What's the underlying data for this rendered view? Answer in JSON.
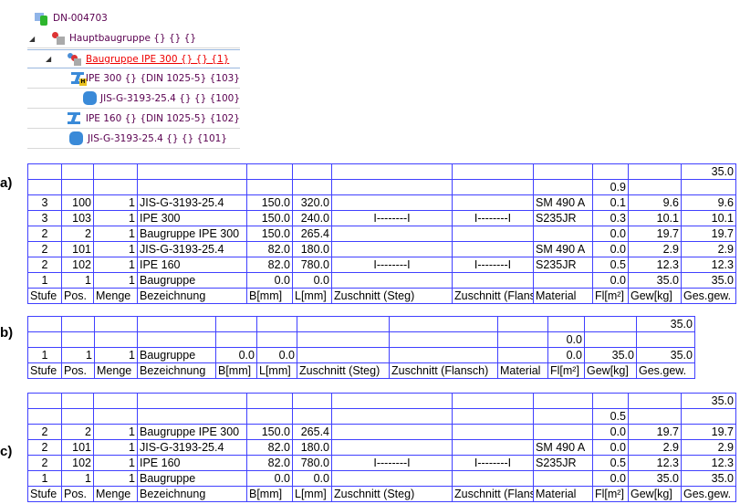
{
  "tree": {
    "root": "DN-004703",
    "items": [
      {
        "label": "Hauptbaugruppe {} {} {}",
        "icon": "assembly-icon",
        "expanded": true
      },
      {
        "label": "Baugruppe IPE 300 {} {} {1}",
        "icon": "assembly-icon",
        "expanded": true,
        "selected": true
      },
      {
        "label": "IPE 300 {} {DIN 1025-5} {103}",
        "icon": "i-beam-icon"
      },
      {
        "label": "JIS-G-3193-25.4 {} {} {100}",
        "icon": "plate-icon"
      },
      {
        "label": "IPE 160 {} {DIN 1025-5} {102}",
        "icon": "i-beam-icon"
      },
      {
        "label": "JIS-G-3193-25.4 {} {} {101}",
        "icon": "plate-icon"
      }
    ]
  },
  "sections": {
    "a": {
      "label": "a)",
      "rows": [
        [
          "",
          "",
          "",
          "",
          "",
          "",
          "",
          "",
          "",
          "",
          "",
          "35.0"
        ],
        [
          "",
          "",
          "",
          "",
          "",
          "",
          "",
          "",
          "",
          "0.9",
          "",
          ""
        ],
        [
          "3",
          "100",
          "1",
          "JIS-G-3193-25.4",
          "150.0",
          "320.0",
          "",
          "",
          "SM 490 A",
          "0.1",
          "9.6",
          "9.6"
        ],
        [
          "3",
          "103",
          "1",
          "IPE 300",
          "150.0",
          "240.0",
          "I--------I",
          "I--------I",
          "S235JR",
          "0.3",
          "10.1",
          "10.1"
        ],
        [
          "2",
          "2",
          "1",
          "Baugruppe IPE 300",
          "150.0",
          "265.4",
          "",
          "",
          "",
          "0.0",
          "19.7",
          "19.7"
        ],
        [
          "2",
          "101",
          "1",
          "JIS-G-3193-25.4",
          "82.0",
          "180.0",
          "",
          "",
          "SM 490 A",
          "0.0",
          "2.9",
          "2.9"
        ],
        [
          "2",
          "102",
          "1",
          "IPE 160",
          "82.0",
          "780.0",
          "I--------I",
          "I--------I",
          "S235JR",
          "0.5",
          "12.3",
          "12.3"
        ],
        [
          "1",
          "1",
          "1",
          "Baugruppe",
          "0.0",
          "0.0",
          "",
          "",
          "",
          "0.0",
          "35.0",
          "35.0"
        ],
        [
          "Stufe",
          "Pos.",
          "Menge",
          "Bezeichnung",
          "B[mm]",
          "L[mm]",
          "Zuschnitt (Steg)",
          "Zuschnitt (Flansch)",
          "Material",
          "Fl[m²]",
          "Gew[kg]",
          "Ges.gew."
        ]
      ]
    },
    "b": {
      "label": "b)",
      "rows": [
        [
          "",
          "",
          "",
          "",
          "",
          "",
          "",
          "",
          "",
          "",
          "",
          "35.0"
        ],
        [
          "",
          "",
          "",
          "",
          "",
          "",
          "",
          "",
          "",
          "0.0",
          "",
          ""
        ],
        [
          "1",
          "1",
          "1",
          "Baugruppe",
          "0.0",
          "0.0",
          "",
          "",
          "",
          "0.0",
          "35.0",
          "35.0"
        ],
        [
          "Stufe",
          "Pos.",
          "Menge",
          "Bezeichnung",
          "B[mm]",
          "L[mm]",
          "Zuschnitt (Steg)",
          "Zuschnitt (Flansch)",
          "Material",
          "Fl[m²]",
          "Gew[kg]",
          "Ges.gew."
        ]
      ]
    },
    "c": {
      "label": "c)",
      "rows": [
        [
          "",
          "",
          "",
          "",
          "",
          "",
          "",
          "",
          "",
          "",
          "",
          "35.0"
        ],
        [
          "",
          "",
          "",
          "",
          "",
          "",
          "",
          "",
          "",
          "0.5",
          "",
          ""
        ],
        [
          "2",
          "2",
          "1",
          "Baugruppe IPE 300",
          "150.0",
          "265.4",
          "",
          "",
          "",
          "0.0",
          "19.7",
          "19.7"
        ],
        [
          "2",
          "101",
          "1",
          "JIS-G-3193-25.4",
          "82.0",
          "180.0",
          "",
          "",
          "SM 490 A",
          "0.0",
          "2.9",
          "2.9"
        ],
        [
          "2",
          "102",
          "1",
          "IPE 160",
          "82.0",
          "780.0",
          "I--------I",
          "I--------I",
          "S235JR",
          "0.5",
          "12.3",
          "12.3"
        ],
        [
          "1",
          "1",
          "1",
          "Baugruppe",
          "0.0",
          "0.0",
          "",
          "",
          "",
          "0.0",
          "35.0",
          "35.0"
        ],
        [
          "Stufe",
          "Pos.",
          "Menge",
          "Bezeichnung",
          "B[mm]",
          "L[mm]",
          "Zuschnitt (Steg)",
          "Zuschnitt (Flansch)",
          "Material",
          "Fl[m²]",
          "Gew[kg]",
          "Ges.gew."
        ]
      ]
    }
  }
}
